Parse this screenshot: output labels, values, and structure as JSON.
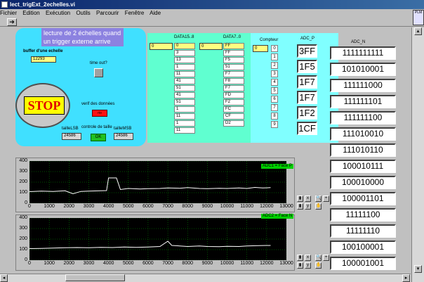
{
  "window": {
    "title": "lect_trigExt_2echelles.vi"
  },
  "menu": [
    "Fichier",
    "Edition",
    "Exécution",
    "Outils",
    "Parcourir",
    "Fenêtre",
    "Aide"
  ],
  "toolbar": {
    "run_icon": "run-arrow-icon"
  },
  "logo_text": "PLM",
  "headline": "lecture de 2 échelles quand un trigger externe arrive",
  "buffer": {
    "label": "buffer d'une echelle",
    "value": "12293"
  },
  "timeout": {
    "label": "time out?"
  },
  "stop": {
    "label": "STOP"
  },
  "verif": {
    "label": "verif des données",
    "led": "rio"
  },
  "taille": {
    "lsb_label": "tailleLSB",
    "lsb_value": "24586",
    "ctrl_label": "controle de taille",
    "ok": "OK",
    "msb_label": "tailleMSB",
    "msb_value": "24586"
  },
  "data15": {
    "label": "DATA15..8",
    "index": "0",
    "index2": "0",
    "values": [
      "0",
      "3",
      "13",
      "1",
      "11",
      "41",
      "51",
      "41",
      "51",
      "1",
      "11",
      "1",
      "11"
    ]
  },
  "data7": {
    "label": "DATA7..0",
    "index": "0",
    "values": [
      "FF",
      "FF",
      "F5",
      "51",
      "F7",
      "F8",
      "F7",
      "FD",
      "F2",
      "FC",
      "CF",
      "D2"
    ]
  },
  "compteur": {
    "label": "Compteur",
    "index": "0",
    "values": [
      "0",
      "1",
      "2",
      "3",
      "4",
      "5",
      "6",
      "7",
      "8",
      "9"
    ]
  },
  "adc_p": {
    "label": "ADC_P",
    "values": [
      "3FF",
      "1F5",
      "1F7",
      "1F7",
      "1F2",
      "1CF"
    ]
  },
  "adc_n": {
    "label": "ADC_N",
    "values": [
      "1111111111",
      "101010001",
      "111111000",
      "111111101",
      "111111100",
      "111010010",
      "111010110",
      "100010111",
      "100010000",
      "100001101",
      "11111100",
      "11111110",
      "100100001",
      "100001001"
    ]
  },
  "chart_data": [
    {
      "type": "line",
      "title": "",
      "series": [
        {
          "name": "ADC1 = Face P"
        }
      ],
      "ylim": [
        0,
        400
      ],
      "xlim": [
        0,
        13000
      ],
      "yticks": [
        "0",
        "100",
        "200",
        "300",
        "400"
      ],
      "xticks": [
        "0",
        "1000",
        "2000",
        "3000",
        "4000",
        "5000",
        "6000",
        "7000",
        "8000",
        "9000",
        "10000",
        "11000",
        "12000",
        "13000"
      ],
      "x": [
        0,
        600,
        1200,
        1800,
        2200,
        2600,
        3000,
        3600,
        3900,
        4000,
        4400,
        4600,
        5000,
        5600,
        6000,
        6600,
        7000,
        7600,
        8000,
        8600,
        9000,
        9600,
        10000,
        10600,
        11000,
        11400,
        11800,
        12200
      ],
      "y": [
        110,
        115,
        112,
        118,
        90,
        112,
        115,
        118,
        120,
        240,
        240,
        130,
        140,
        135,
        138,
        140,
        145,
        142,
        148,
        140,
        138,
        142,
        140,
        145,
        140,
        150,
        145,
        148
      ]
    },
    {
      "type": "line",
      "title": "",
      "series": [
        {
          "name": "ADC2 = Face N"
        }
      ],
      "ylim": [
        0,
        400
      ],
      "xlim": [
        0,
        13000
      ],
      "yticks": [
        "0",
        "100",
        "200",
        "300",
        "400"
      ],
      "xticks": [
        "0",
        "1000",
        "2000",
        "3000",
        "4000",
        "5000",
        "6000",
        "7000",
        "8000",
        "9000",
        "10000",
        "11000",
        "12000",
        "13000"
      ],
      "x": [
        0,
        600,
        1200,
        1800,
        2400,
        3000,
        3600,
        4200,
        4800,
        5400,
        6000,
        6600,
        7000,
        7200,
        7600,
        8000,
        8600,
        9000,
        9600,
        10000,
        10600,
        11000,
        11600,
        12200
      ],
      "y": [
        110,
        112,
        115,
        118,
        120,
        118,
        122,
        120,
        125,
        122,
        125,
        130,
        180,
        140,
        135,
        130,
        135,
        130,
        128,
        132,
        130,
        135,
        138,
        140
      ]
    }
  ]
}
